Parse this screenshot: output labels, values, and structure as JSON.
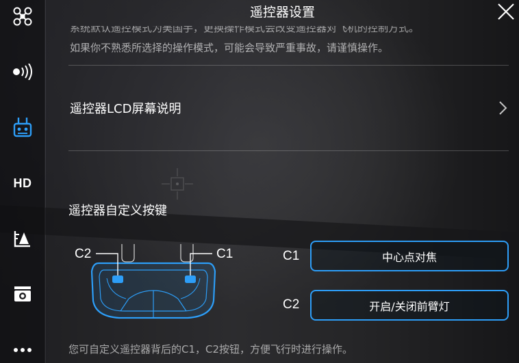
{
  "sidebar": {
    "items": [
      {
        "icon": "aircraft-icon"
      },
      {
        "icon": "signal-icon"
      },
      {
        "icon": "remote-controller-icon",
        "active": true
      },
      {
        "icon": "hd-icon",
        "label": "HD"
      },
      {
        "icon": "flight-battery-icon"
      },
      {
        "icon": "camera-icon"
      },
      {
        "icon": "more-icon"
      }
    ]
  },
  "header": {
    "title": "遥控器设置",
    "close_icon": "close-icon"
  },
  "warning": {
    "line1_partial": "系统默认遥控模式为美国手，更换操作模式会改变遥控器对飞机的控制方式。",
    "line2": "如果你不熟悉所选择的操作模式，可能会导致严重事故，请谨慎操作。"
  },
  "lcd_row": {
    "label": "遥控器LCD屏幕说明"
  },
  "custom_keys": {
    "title": "遥控器自定义按键",
    "figure_c2": "C2",
    "figure_c1": "C1",
    "c1_label": "C1",
    "c1_value": "中心点对焦",
    "c2_label": "C2",
    "c2_value": "开启/关闭前臂灯",
    "hint": "您可自定义遥控器背后的C1，C2按钮，方便飞行时进行操作。"
  },
  "colors": {
    "accent": "#2d9ef8",
    "panel_text": "#ffffff"
  }
}
